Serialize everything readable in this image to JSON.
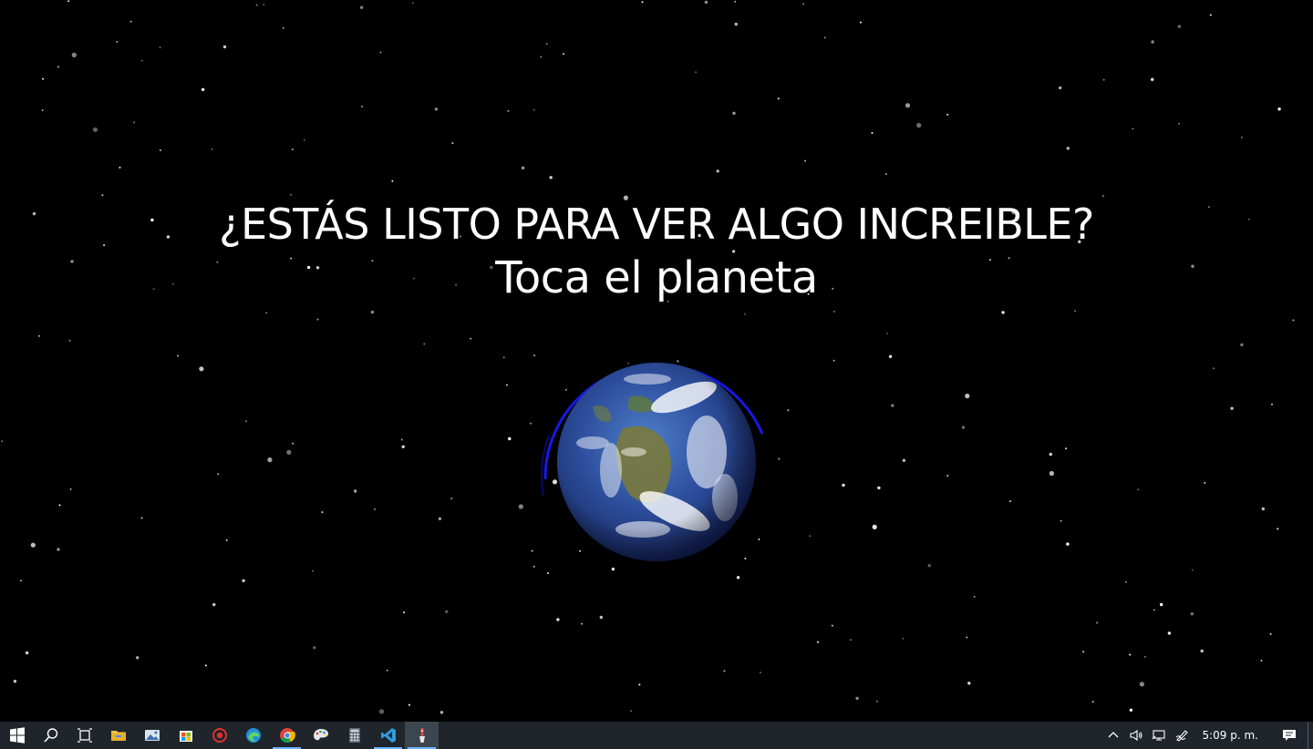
{
  "page": {
    "title_line": "¿ESTÁS LISTO PARA VER ALGO INCREIBLE?",
    "subtitle_line": "Toca el planeta"
  },
  "colors": {
    "background": "#000000",
    "text": "#ffffff",
    "planet_ring": "#1a1aff",
    "taskbar": "#1f252b",
    "taskbar_active_indicator": "#6fb3ff"
  },
  "taskbar": {
    "apps": [
      {
        "name": "windows-start-icon",
        "active": false
      },
      {
        "name": "search-icon",
        "active": false
      },
      {
        "name": "task-view-icon",
        "active": false
      },
      {
        "name": "file-explorer-icon",
        "active": false
      },
      {
        "name": "photos-app-icon",
        "active": false
      },
      {
        "name": "microsoft-store-icon",
        "active": false
      },
      {
        "name": "red-circle-app-icon",
        "active": false
      },
      {
        "name": "edge-browser-icon",
        "active": false
      },
      {
        "name": "chrome-browser-icon",
        "active": true
      },
      {
        "name": "paint-app-icon",
        "active": false
      },
      {
        "name": "calculator-icon",
        "active": false
      },
      {
        "name": "vscode-icon",
        "active": true
      },
      {
        "name": "tool-app-icon",
        "active": true,
        "focused": true
      }
    ],
    "tray_icons": [
      "chevron-up-icon",
      "volume-icon",
      "network-icon",
      "pen-workspace-icon"
    ],
    "clock": "5:09 p. m.",
    "notification_icon": "action-center-icon"
  }
}
